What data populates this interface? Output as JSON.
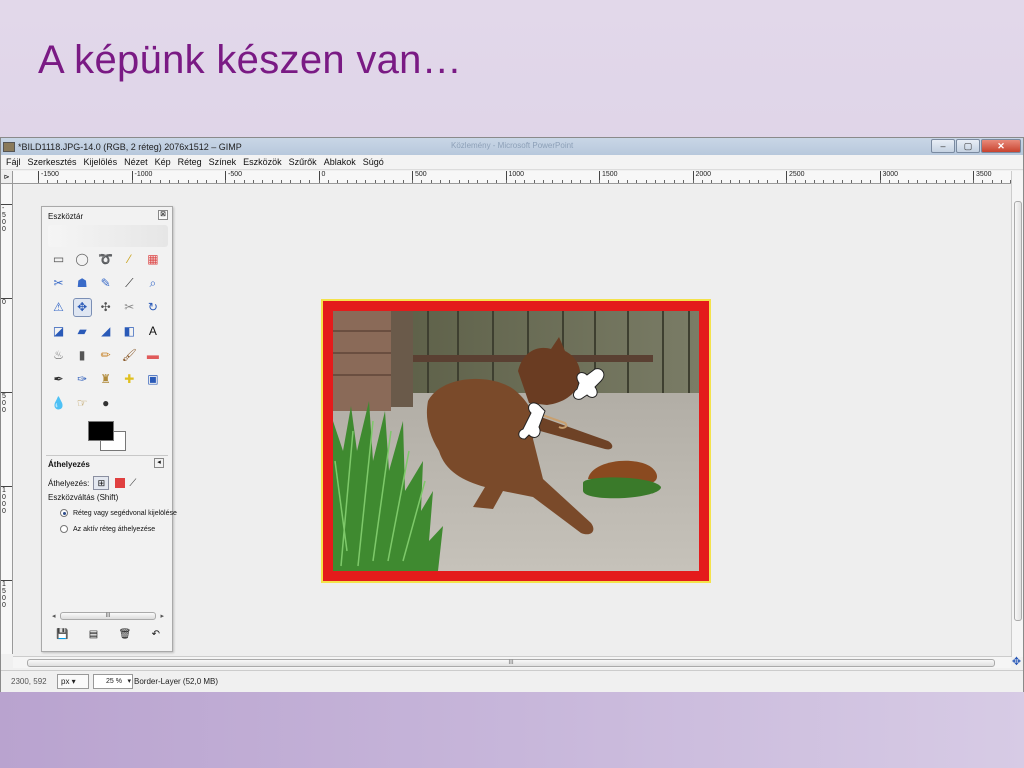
{
  "slide": {
    "title": "A képünk készen van…"
  },
  "window": {
    "title": "*BILD1118.JPG-14.0 (RGB, 2 réteg) 2076x1512 – GIMP",
    "background_title": "Közlemény - Microsoft PowerPoint",
    "controls": [
      "–",
      "▢",
      "✕"
    ]
  },
  "menu": [
    "Fájl",
    "Szerkesztés",
    "Kijelölés",
    "Nézet",
    "Kép",
    "Réteg",
    "Színek",
    "Eszközök",
    "Szűrők",
    "Ablakok",
    "Súgó"
  ],
  "ruler": {
    "corner": "⊳",
    "horizontal_labels": [
      "-1500",
      "-1000",
      "-500",
      "0",
      "500",
      "1000",
      "1500",
      "2000",
      "2500",
      "3000",
      "3500"
    ],
    "vertical_labels": [
      "-500",
      "0",
      "500",
      "1000",
      "1500"
    ]
  },
  "toolbox": {
    "title": "Eszköztár",
    "close": "⊠",
    "tools": [
      {
        "name": "rect-select-icon",
        "glyph": "▭",
        "color": "#555"
      },
      {
        "name": "ellipse-select-icon",
        "glyph": "◯",
        "color": "#666"
      },
      {
        "name": "free-select-icon",
        "glyph": "➰",
        "color": "#666"
      },
      {
        "name": "fuzzy-select-icon",
        "glyph": "⁄",
        "color": "#c9a21a"
      },
      {
        "name": "select-by-color-icon",
        "glyph": "▦",
        "color": "#d44"
      },
      {
        "name": "scissors-select-icon",
        "glyph": "✂",
        "color": "#3a6bc8"
      },
      {
        "name": "foreground-select-icon",
        "glyph": "☗",
        "color": "#3a6bc8"
      },
      {
        "name": "paths-icon",
        "glyph": "✎",
        "color": "#3a6bc8"
      },
      {
        "name": "color-picker-icon",
        "glyph": "⟋",
        "color": "#333"
      },
      {
        "name": "zoom-icon",
        "glyph": "⌕",
        "color": "#3a6bc8"
      },
      {
        "name": "measure-icon",
        "glyph": "⚠",
        "color": "#3a6bc8"
      },
      {
        "name": "move-icon",
        "glyph": "✥",
        "color": "#2a5ab8"
      },
      {
        "name": "align-icon",
        "glyph": "✣",
        "color": "#555"
      },
      {
        "name": "crop-icon",
        "glyph": "✂",
        "color": "#888"
      },
      {
        "name": "rotate-icon",
        "glyph": "↻",
        "color": "#2a5ab8"
      },
      {
        "name": "scale-icon",
        "glyph": "◪",
        "color": "#2a5ab8"
      },
      {
        "name": "shear-icon",
        "glyph": "▰",
        "color": "#2a5ab8"
      },
      {
        "name": "perspective-icon",
        "glyph": "◢",
        "color": "#2a5ab8"
      },
      {
        "name": "flip-icon",
        "glyph": "◧",
        "color": "#2a5ab8"
      },
      {
        "name": "text-icon",
        "glyph": "A",
        "color": "#111"
      },
      {
        "name": "bucket-fill-icon",
        "glyph": "♨",
        "color": "#666"
      },
      {
        "name": "blend-icon",
        "glyph": "▮",
        "color": "#555"
      },
      {
        "name": "pencil-icon",
        "glyph": "✏",
        "color": "#c8842a"
      },
      {
        "name": "paintbrush-icon",
        "glyph": "🖌",
        "color": "#8a5a2a"
      },
      {
        "name": "eraser-icon",
        "glyph": "▬",
        "color": "#e05a5a"
      },
      {
        "name": "airbrush-icon",
        "glyph": "✒",
        "color": "#333"
      },
      {
        "name": "ink-icon",
        "glyph": "✑",
        "color": "#2a5ab8"
      },
      {
        "name": "clone-icon",
        "glyph": "♜",
        "color": "#b08a3a"
      },
      {
        "name": "heal-icon",
        "glyph": "✚",
        "color": "#e0c020"
      },
      {
        "name": "perspective-clone-icon",
        "glyph": "▣",
        "color": "#2a5ab8"
      },
      {
        "name": "blur-icon",
        "glyph": "💧",
        "color": "#3a7ac8"
      },
      {
        "name": "smudge-icon",
        "glyph": "☞",
        "color": "#b08a3a"
      },
      {
        "name": "dodge-burn-icon",
        "glyph": "●",
        "color": "#333"
      }
    ],
    "options": {
      "title": "Áthelyezés",
      "collapse": "◂",
      "move_label": "Áthelyezés:",
      "switch_label": "Eszközváltás  (Shift)",
      "radio_1": "Réteg vagy segédvonal kijelölése",
      "radio_2": "Az aktív réteg áthelyezése"
    },
    "scroll_left": "◂",
    "scroll_right": "▸",
    "scroll_grip": "III",
    "bottom_icons": [
      "💾",
      "▤",
      "🗑",
      "↶"
    ]
  },
  "scrollbar": {
    "grip": "III"
  },
  "status": {
    "coords": "2300, 592",
    "unit": "px",
    "zoom": "25 %",
    "layer": "Border-Layer (52,0 MB)"
  },
  "colors": {
    "title": "#7a1a84",
    "border": "#e41b1b"
  }
}
